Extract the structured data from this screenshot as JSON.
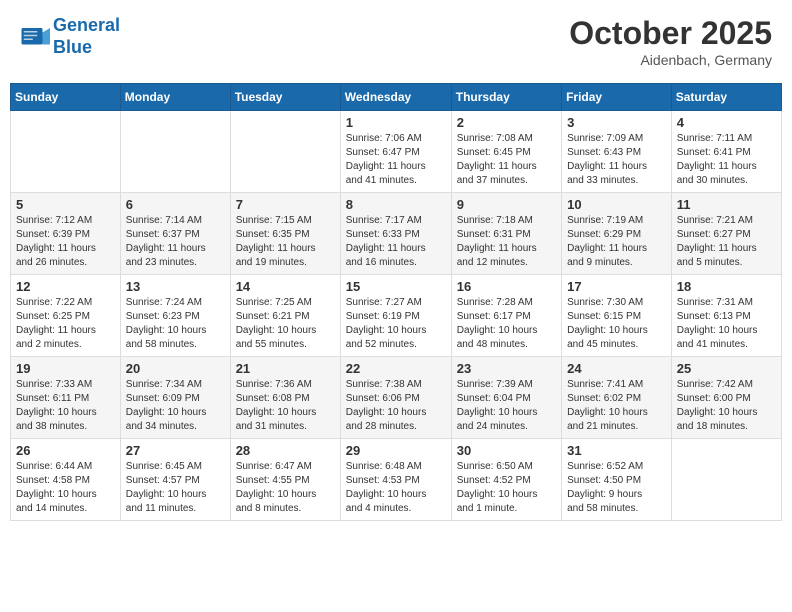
{
  "header": {
    "logo_line1": "General",
    "logo_line2": "Blue",
    "month": "October 2025",
    "location": "Aidenbach, Germany"
  },
  "weekdays": [
    "Sunday",
    "Monday",
    "Tuesday",
    "Wednesday",
    "Thursday",
    "Friday",
    "Saturday"
  ],
  "weeks": [
    [
      {
        "day": "",
        "info": ""
      },
      {
        "day": "",
        "info": ""
      },
      {
        "day": "",
        "info": ""
      },
      {
        "day": "1",
        "info": "Sunrise: 7:06 AM\nSunset: 6:47 PM\nDaylight: 11 hours\nand 41 minutes."
      },
      {
        "day": "2",
        "info": "Sunrise: 7:08 AM\nSunset: 6:45 PM\nDaylight: 11 hours\nand 37 minutes."
      },
      {
        "day": "3",
        "info": "Sunrise: 7:09 AM\nSunset: 6:43 PM\nDaylight: 11 hours\nand 33 minutes."
      },
      {
        "day": "4",
        "info": "Sunrise: 7:11 AM\nSunset: 6:41 PM\nDaylight: 11 hours\nand 30 minutes."
      }
    ],
    [
      {
        "day": "5",
        "info": "Sunrise: 7:12 AM\nSunset: 6:39 PM\nDaylight: 11 hours\nand 26 minutes."
      },
      {
        "day": "6",
        "info": "Sunrise: 7:14 AM\nSunset: 6:37 PM\nDaylight: 11 hours\nand 23 minutes."
      },
      {
        "day": "7",
        "info": "Sunrise: 7:15 AM\nSunset: 6:35 PM\nDaylight: 11 hours\nand 19 minutes."
      },
      {
        "day": "8",
        "info": "Sunrise: 7:17 AM\nSunset: 6:33 PM\nDaylight: 11 hours\nand 16 minutes."
      },
      {
        "day": "9",
        "info": "Sunrise: 7:18 AM\nSunset: 6:31 PM\nDaylight: 11 hours\nand 12 minutes."
      },
      {
        "day": "10",
        "info": "Sunrise: 7:19 AM\nSunset: 6:29 PM\nDaylight: 11 hours\nand 9 minutes."
      },
      {
        "day": "11",
        "info": "Sunrise: 7:21 AM\nSunset: 6:27 PM\nDaylight: 11 hours\nand 5 minutes."
      }
    ],
    [
      {
        "day": "12",
        "info": "Sunrise: 7:22 AM\nSunset: 6:25 PM\nDaylight: 11 hours\nand 2 minutes."
      },
      {
        "day": "13",
        "info": "Sunrise: 7:24 AM\nSunset: 6:23 PM\nDaylight: 10 hours\nand 58 minutes."
      },
      {
        "day": "14",
        "info": "Sunrise: 7:25 AM\nSunset: 6:21 PM\nDaylight: 10 hours\nand 55 minutes."
      },
      {
        "day": "15",
        "info": "Sunrise: 7:27 AM\nSunset: 6:19 PM\nDaylight: 10 hours\nand 52 minutes."
      },
      {
        "day": "16",
        "info": "Sunrise: 7:28 AM\nSunset: 6:17 PM\nDaylight: 10 hours\nand 48 minutes."
      },
      {
        "day": "17",
        "info": "Sunrise: 7:30 AM\nSunset: 6:15 PM\nDaylight: 10 hours\nand 45 minutes."
      },
      {
        "day": "18",
        "info": "Sunrise: 7:31 AM\nSunset: 6:13 PM\nDaylight: 10 hours\nand 41 minutes."
      }
    ],
    [
      {
        "day": "19",
        "info": "Sunrise: 7:33 AM\nSunset: 6:11 PM\nDaylight: 10 hours\nand 38 minutes."
      },
      {
        "day": "20",
        "info": "Sunrise: 7:34 AM\nSunset: 6:09 PM\nDaylight: 10 hours\nand 34 minutes."
      },
      {
        "day": "21",
        "info": "Sunrise: 7:36 AM\nSunset: 6:08 PM\nDaylight: 10 hours\nand 31 minutes."
      },
      {
        "day": "22",
        "info": "Sunrise: 7:38 AM\nSunset: 6:06 PM\nDaylight: 10 hours\nand 28 minutes."
      },
      {
        "day": "23",
        "info": "Sunrise: 7:39 AM\nSunset: 6:04 PM\nDaylight: 10 hours\nand 24 minutes."
      },
      {
        "day": "24",
        "info": "Sunrise: 7:41 AM\nSunset: 6:02 PM\nDaylight: 10 hours\nand 21 minutes."
      },
      {
        "day": "25",
        "info": "Sunrise: 7:42 AM\nSunset: 6:00 PM\nDaylight: 10 hours\nand 18 minutes."
      }
    ],
    [
      {
        "day": "26",
        "info": "Sunrise: 6:44 AM\nSunset: 4:58 PM\nDaylight: 10 hours\nand 14 minutes."
      },
      {
        "day": "27",
        "info": "Sunrise: 6:45 AM\nSunset: 4:57 PM\nDaylight: 10 hours\nand 11 minutes."
      },
      {
        "day": "28",
        "info": "Sunrise: 6:47 AM\nSunset: 4:55 PM\nDaylight: 10 hours\nand 8 minutes."
      },
      {
        "day": "29",
        "info": "Sunrise: 6:48 AM\nSunset: 4:53 PM\nDaylight: 10 hours\nand 4 minutes."
      },
      {
        "day": "30",
        "info": "Sunrise: 6:50 AM\nSunset: 4:52 PM\nDaylight: 10 hours\nand 1 minute."
      },
      {
        "day": "31",
        "info": "Sunrise: 6:52 AM\nSunset: 4:50 PM\nDaylight: 9 hours\nand 58 minutes."
      },
      {
        "day": "",
        "info": ""
      }
    ]
  ]
}
